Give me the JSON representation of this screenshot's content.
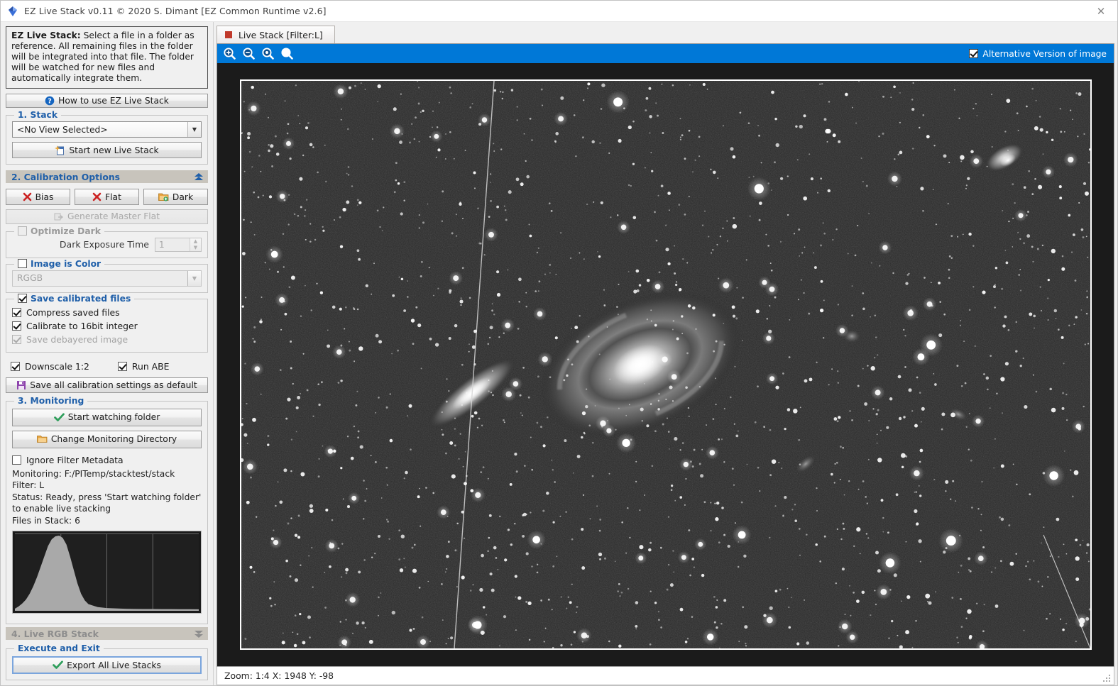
{
  "window": {
    "title": "EZ Live Stack v0.11 © 2020 S. Dimant [EZ Common Runtime v2.6]",
    "close_label": "✕",
    "app_icon": "diamond-gem-icon"
  },
  "sidebar": {
    "help": {
      "lead": "EZ Live Stack:",
      "text": " Select a file in a folder as reference. All remaining files in the folder will be integrated into that file. The folder will be watched for new files and automatically integrate them."
    },
    "how_to_button": "How to use EZ Live Stack",
    "stack": {
      "group_label": "1. Stack",
      "view_select_value": "<No View Selected>",
      "start_button": "Start new Live Stack"
    },
    "calibration": {
      "header": "2. Calibration Options",
      "bias_button": "Bias",
      "flat_button": "Flat",
      "dark_button": "Dark",
      "generate_master_flat_button": "Generate Master Flat",
      "optimize_dark": {
        "label": "Optimize Dark",
        "checked": false,
        "exposure_label": "Dark Exposure Time",
        "exposure_value": "1"
      },
      "image_is_color": {
        "label": "Image is Color",
        "checked": false,
        "pattern_value": "RGGB"
      },
      "save_calibrated": {
        "label": "Save calibrated files",
        "checked": true,
        "options": [
          {
            "label": "Compress saved files",
            "checked": true,
            "enabled": true
          },
          {
            "label": "Calibrate to 16bit integer",
            "checked": true,
            "enabled": true
          },
          {
            "label": "Save debayered image",
            "checked": true,
            "enabled": false
          }
        ]
      },
      "downscale": {
        "label": "Downscale 1:2",
        "checked": true
      },
      "run_abe": {
        "label": "Run ABE",
        "checked": true
      },
      "save_defaults_button": "Save all calibration settings as default"
    },
    "monitoring": {
      "group_label": "3. Monitoring",
      "start_watching_button": "Start watching folder",
      "change_directory_button": "Change Monitoring Directory",
      "ignore_filter_metadata": {
        "label": "Ignore Filter Metadata",
        "checked": false
      },
      "monitoring_path": "Monitoring: F:/PITemp/stacktest/stack",
      "filter": "Filter: L",
      "status": "Status: Ready, press 'Start watching folder' to enable live stacking",
      "files_in_stack": "Files in Stack: 6"
    },
    "live_rgb_stack_header": "4. Live RGB Stack",
    "execute": {
      "group_label": "Execute and Exit",
      "export_button": "Export All Live Stacks"
    }
  },
  "viewer": {
    "tab_label": "Live Stack [Filter:L]",
    "tools": [
      {
        "name": "zoom-in-icon",
        "title": "Zoom In"
      },
      {
        "name": "zoom-out-icon",
        "title": "Zoom Out"
      },
      {
        "name": "zoom-actual-icon",
        "title": "Zoom 1:1"
      },
      {
        "name": "zoom-fit-icon",
        "title": "Zoom to Fit"
      }
    ],
    "alternative_version": {
      "label": "Alternative Version of image",
      "checked": true
    },
    "status": "Zoom: 1:4   X: 1948   Y: -98"
  },
  "colors": {
    "accent_blue": "#0078d7",
    "group_label_blue": "#1f5fa9",
    "section_header_bg": "#c8c4bc",
    "tab_marker_red": "#c0392b",
    "folder_orange": "#e8a33d",
    "check_green": "#2e9e5b",
    "x_red": "#cc2222",
    "floppy_purple": "#8e44ad"
  },
  "chart_data": {
    "type": "line",
    "title": "Stack histogram",
    "xlabel": "",
    "ylabel": "",
    "xlim": [
      0,
      1
    ],
    "ylim": [
      0,
      1
    ],
    "grid": true,
    "gridlines_x": [
      0.25,
      0.5,
      0.75
    ],
    "x": [
      0.0,
      0.02,
      0.04,
      0.06,
      0.08,
      0.1,
      0.12,
      0.14,
      0.16,
      0.18,
      0.2,
      0.22,
      0.24,
      0.26,
      0.28,
      0.3,
      0.32,
      0.34,
      0.36,
      0.38,
      0.4,
      0.45,
      0.5,
      0.55,
      0.6,
      0.65,
      0.7,
      0.75,
      0.8,
      0.85,
      0.9,
      0.95,
      1.0
    ],
    "values": [
      0.02,
      0.05,
      0.09,
      0.14,
      0.22,
      0.32,
      0.44,
      0.58,
      0.72,
      0.86,
      0.95,
      0.99,
      1.0,
      0.97,
      0.88,
      0.72,
      0.54,
      0.36,
      0.22,
      0.13,
      0.08,
      0.04,
      0.028,
      0.022,
      0.018,
      0.016,
      0.015,
      0.014,
      0.013,
      0.013,
      0.012,
      0.012,
      0.011
    ]
  },
  "image": {
    "description": "Monochrome deep-sky exposure: M81 and M82 galaxies with starfield and two faint satellite trails",
    "galaxies": [
      {
        "name": "M82",
        "cx": 0.27,
        "cy": 0.55,
        "rx": 0.055,
        "ry": 0.016,
        "angle": -38
      },
      {
        "name": "M81",
        "cx": 0.47,
        "cy": 0.5,
        "rx": 0.085,
        "ry": 0.05,
        "angle": -24
      }
    ]
  }
}
